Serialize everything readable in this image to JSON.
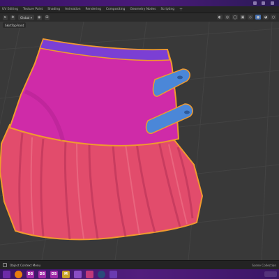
{
  "window": {
    "top_strip_color": "#3f1670"
  },
  "workspaces": {
    "tabs": [
      {
        "label": "UV Editing"
      },
      {
        "label": "Texture Paint"
      },
      {
        "label": "Shading"
      },
      {
        "label": "Animation"
      },
      {
        "label": "Rendering"
      },
      {
        "label": "Compositing"
      },
      {
        "label": "Geometry Nodes"
      },
      {
        "label": "Scripting"
      }
    ],
    "add_tab_symbol": "+"
  },
  "viewport_header": {
    "transform_orientation": "Global",
    "left_icons": [
      "cursor-icon",
      "move-icon"
    ],
    "right_icons": [
      "view-icon",
      "camera-icon",
      "overlay-icon",
      "xray-icon",
      "wireframe-icon",
      "solid-shading-icon",
      "material-preview-icon",
      "rendered-shading-icon"
    ]
  },
  "active_object": {
    "label": "SkirtTopFront"
  },
  "viewport": {
    "background_color": "#393939",
    "grid_color": "#444444",
    "model": "pleated-skirt",
    "waistband_color": "#7a3fd0",
    "skirt_top_color": "#cc2aa6",
    "pleats_color": "#e54b6a",
    "strap_color": "#4a86d6",
    "selection_outline_color": "#f09a2e"
  },
  "status_bar": {
    "left_text": "Object Context Menu",
    "right_text": "Scene Collection"
  },
  "taskbar": {
    "icons": [
      {
        "name": "start-icon",
        "text": "",
        "color": "#6d2aa8"
      },
      {
        "name": "blender-icon",
        "text": "",
        "color": "#e87d0d"
      },
      {
        "name": "daz-icon",
        "text": "DS",
        "color": "#a02aa8"
      },
      {
        "name": "daz-icon-2",
        "text": "DS",
        "color": "#a02aa8"
      },
      {
        "name": "daz-icon-3",
        "text": "DS",
        "color": "#a02aa8"
      },
      {
        "name": "marvelous-icon",
        "text": "M",
        "color": "#c9a227"
      },
      {
        "name": "app-icon",
        "text": "",
        "color": "#8a4dc4"
      },
      {
        "name": "app-icon-2",
        "text": "",
        "color": "#c0397a"
      },
      {
        "name": "steam-icon",
        "text": "",
        "color": "#2a4a7a"
      },
      {
        "name": "app-icon-3",
        "text": "",
        "color": "#6a3ab0"
      }
    ]
  }
}
